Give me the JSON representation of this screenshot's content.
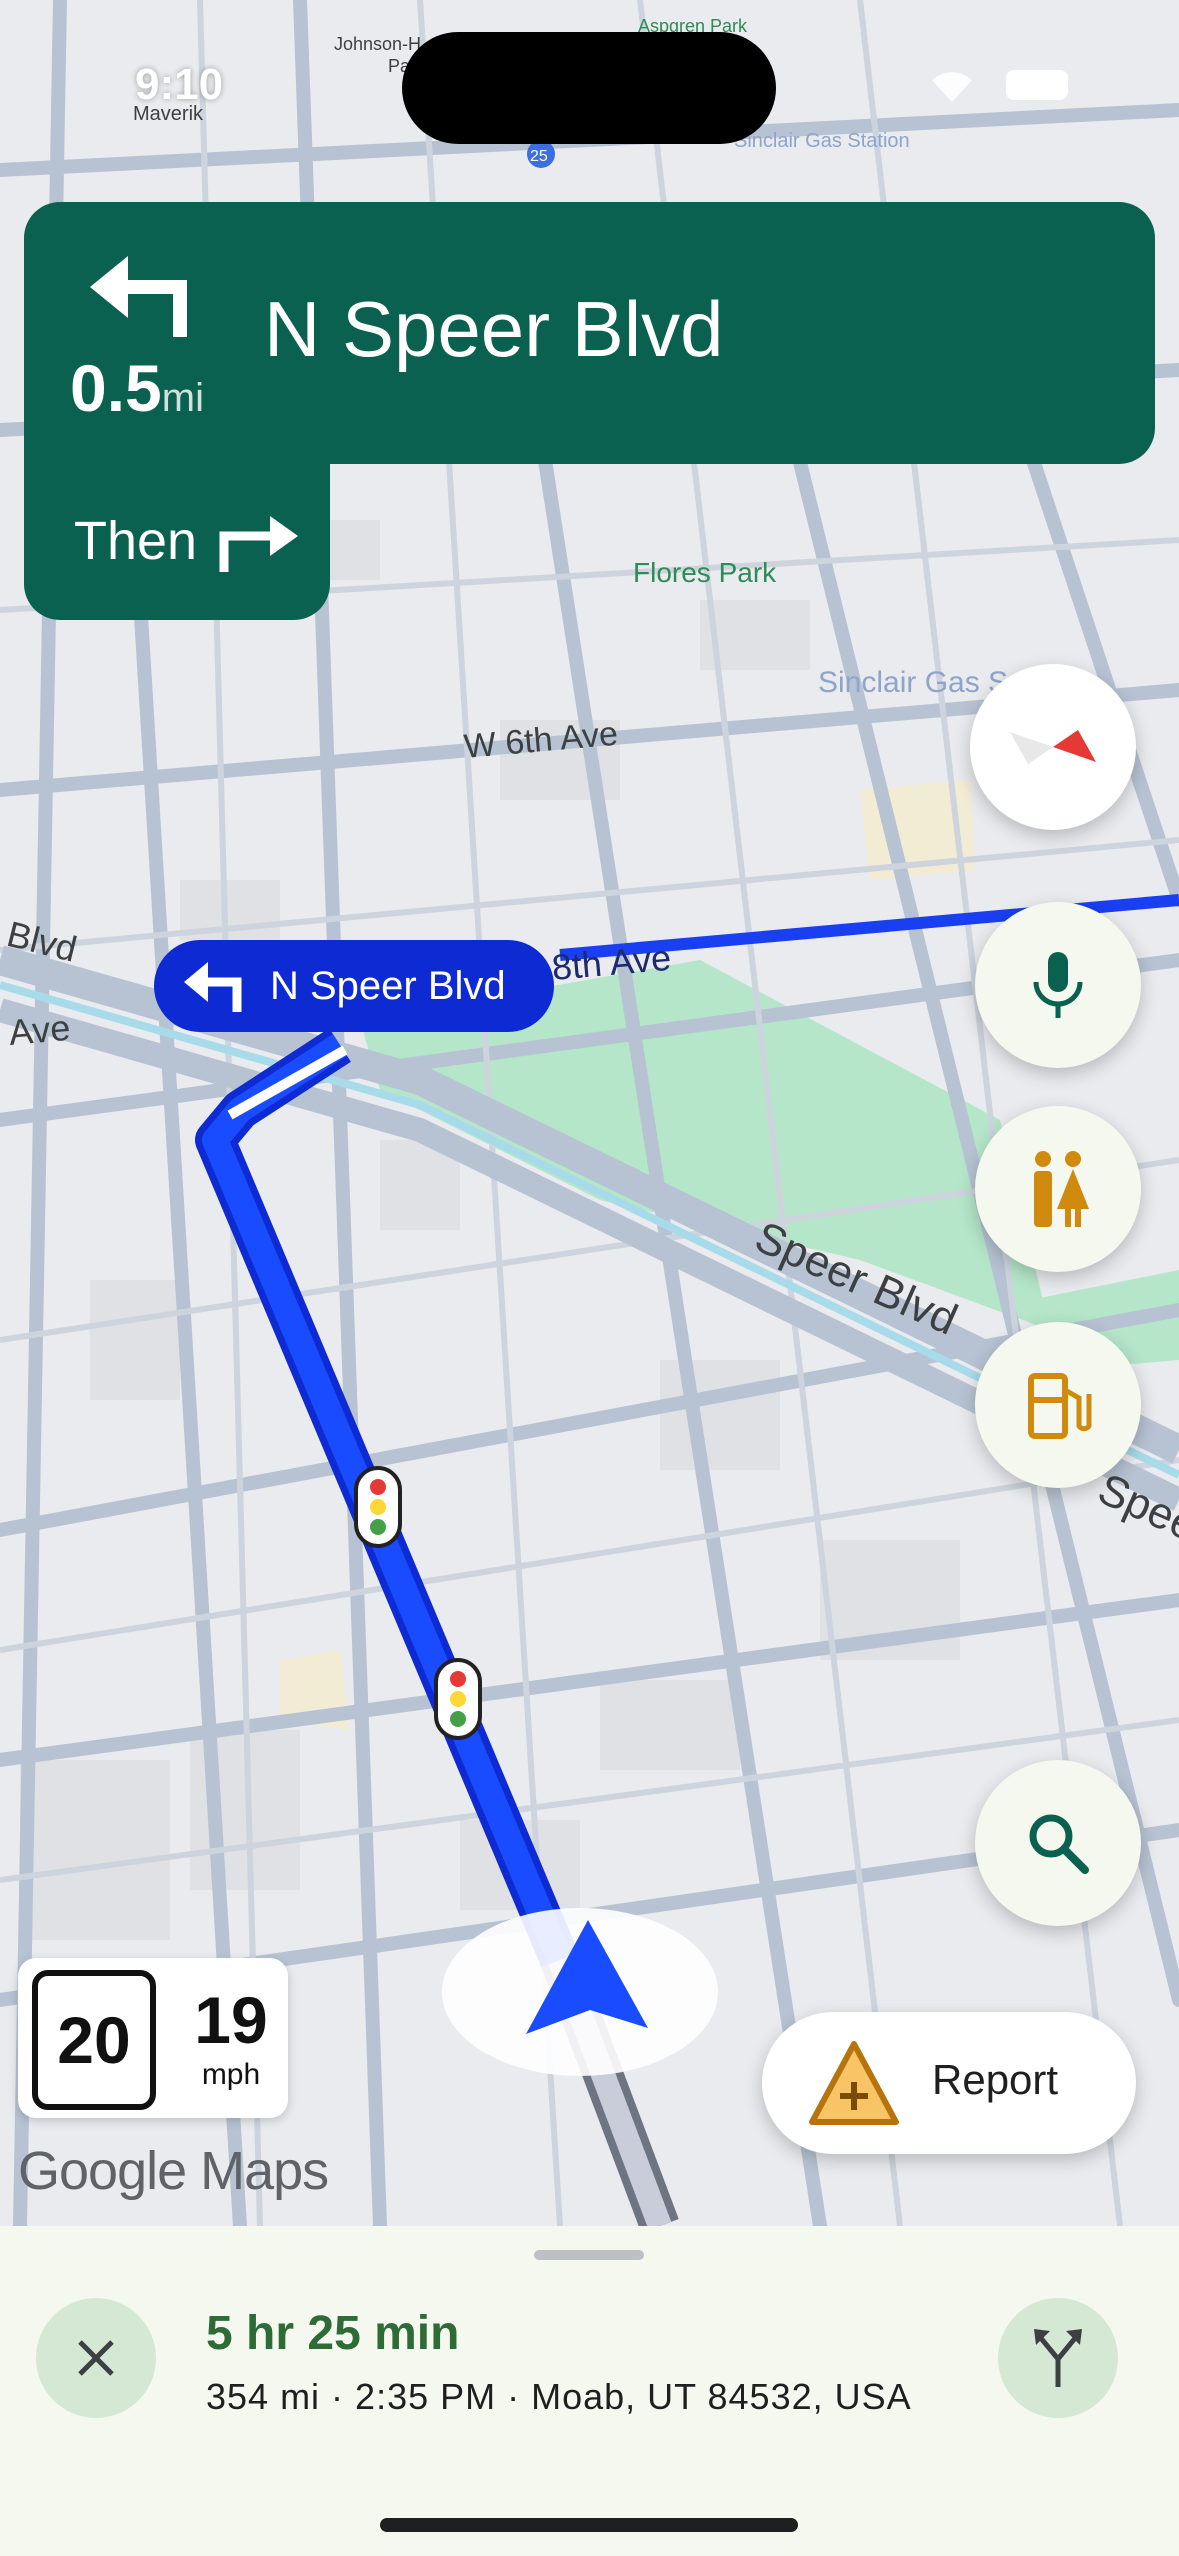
{
  "status_bar": {
    "time": "9:10"
  },
  "map": {
    "labels": {
      "flores_park": "Flores Park",
      "w6th": "W 6th Ave",
      "w8th": "8th Ave",
      "speer": "Speer Blvd",
      "blvd_left": "Blvd",
      "ave_left": "Ave",
      "sinclair": "Sinclair Gas S",
      "sinclair_top": "Sinclair Gas Station",
      "johnson": "Johnson-H",
      "pa": "Pa",
      "aspgren": "Aspgren Park",
      "maverik": "Maverik",
      "route_25": "25",
      "speer_right": "Speer"
    }
  },
  "navigation": {
    "maneuver_icon": "turn-left-icon",
    "distance": "0.5",
    "distance_unit": "mi",
    "street": "N Speer Blvd",
    "then_label": "Then",
    "then_icon": "turn-right-icon"
  },
  "route_label": {
    "icon": "turn-left-icon",
    "text": "N Speer Blvd"
  },
  "controls": {
    "compass": "compass-icon",
    "voice": "microphone-icon",
    "restrooms": "restroom-icon",
    "gas": "gas-station-icon",
    "search": "search-icon"
  },
  "speed": {
    "limit": "20",
    "current": "19",
    "unit": "mph"
  },
  "brand": {
    "logo_text": "Google Maps"
  },
  "report": {
    "label": "Report",
    "icon": "report-incident-icon"
  },
  "trip": {
    "duration": "5 hr 25 min",
    "details": "354 mi · 2:35 PM · Moab, UT 84532, USA"
  },
  "colors": {
    "nav_green": "#0b6150",
    "route_blue": "#1a3ff0",
    "park_green": "#b5e6c9",
    "eta_green": "#2e6b36",
    "sheet_bg": "#f5f8ef"
  }
}
